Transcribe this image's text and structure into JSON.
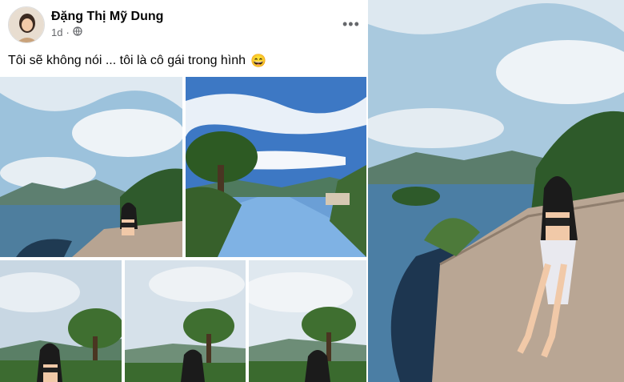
{
  "post": {
    "author_name": "Đặng Thị Mỹ Dung",
    "time": "1d",
    "privacy_icon": "globe-icon",
    "more_icon": "more-dots-icon",
    "more_label": "•••",
    "caption": "Tôi sẽ không nói ... tôi là cô gái trong hình",
    "emoji": "😄"
  },
  "photos": [
    {
      "name": "lake-girl-rocks"
    },
    {
      "name": "sky-river-lake"
    },
    {
      "name": "girl-trees-1"
    },
    {
      "name": "girl-trees-2"
    },
    {
      "name": "girl-trees-3"
    },
    {
      "name": "large-lake-girl-rocks"
    }
  ],
  "colors": {
    "accent": "#1877f2",
    "meta": "#65676b"
  }
}
